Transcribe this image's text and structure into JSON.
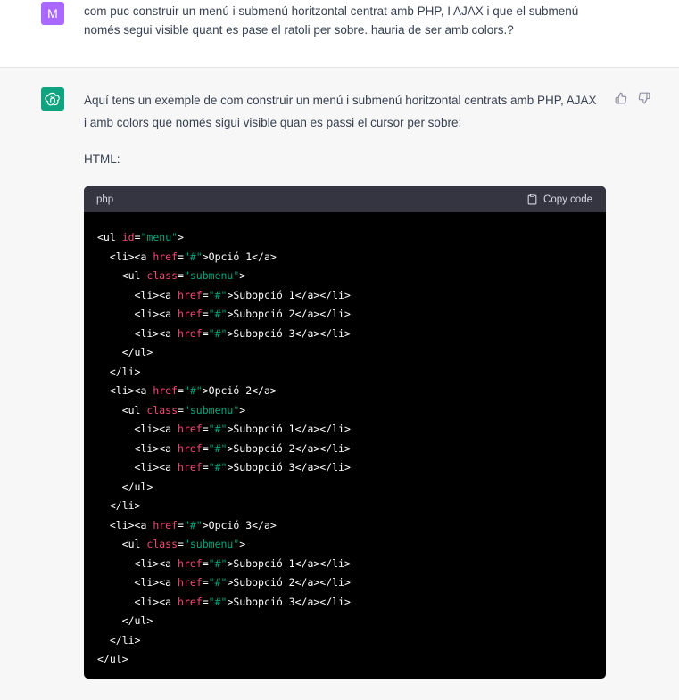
{
  "user_message": {
    "avatar_initial": "M",
    "text": "com puc construir un menú i submenú horitzontal centrat amb PHP, I AJAX i que el submenú només segui visible quant es pase el ratoli per sobre. hauria de ser amb colors.?"
  },
  "assistant_message": {
    "intro": "Aquí tens un exemple de com construir un menú i submenú horitzontal centrats amb PHP, AJAX i amb colors que només sigui visible quan es passi el cursor per sobre:",
    "html_label": "HTML:",
    "code_block": {
      "language": "php",
      "copy_label": "Copy code",
      "lines": [
        [
          {
            "t": "plain",
            "s": "<ul "
          },
          {
            "t": "attr",
            "s": "id"
          },
          {
            "t": "plain",
            "s": "="
          },
          {
            "t": "val",
            "s": "\"menu\""
          },
          {
            "t": "plain",
            "s": ">"
          }
        ],
        [
          {
            "t": "plain",
            "s": "  <li><a "
          },
          {
            "t": "attr",
            "s": "href"
          },
          {
            "t": "plain",
            "s": "="
          },
          {
            "t": "val",
            "s": "\"#\""
          },
          {
            "t": "plain",
            "s": ">Opció 1</a>"
          }
        ],
        [
          {
            "t": "plain",
            "s": "    <ul "
          },
          {
            "t": "attr",
            "s": "class"
          },
          {
            "t": "plain",
            "s": "="
          },
          {
            "t": "val",
            "s": "\"submenu\""
          },
          {
            "t": "plain",
            "s": ">"
          }
        ],
        [
          {
            "t": "plain",
            "s": "      <li><a "
          },
          {
            "t": "attr",
            "s": "href"
          },
          {
            "t": "plain",
            "s": "="
          },
          {
            "t": "val",
            "s": "\"#\""
          },
          {
            "t": "plain",
            "s": ">Subopció 1</a></li>"
          }
        ],
        [
          {
            "t": "plain",
            "s": "      <li><a "
          },
          {
            "t": "attr",
            "s": "href"
          },
          {
            "t": "plain",
            "s": "="
          },
          {
            "t": "val",
            "s": "\"#\""
          },
          {
            "t": "plain",
            "s": ">Subopció 2</a></li>"
          }
        ],
        [
          {
            "t": "plain",
            "s": "      <li><a "
          },
          {
            "t": "attr",
            "s": "href"
          },
          {
            "t": "plain",
            "s": "="
          },
          {
            "t": "val",
            "s": "\"#\""
          },
          {
            "t": "plain",
            "s": ">Subopció 3</a></li>"
          }
        ],
        [
          {
            "t": "plain",
            "s": "    </ul>"
          }
        ],
        [
          {
            "t": "plain",
            "s": "  </li>"
          }
        ],
        [
          {
            "t": "plain",
            "s": "  <li><a "
          },
          {
            "t": "attr",
            "s": "href"
          },
          {
            "t": "plain",
            "s": "="
          },
          {
            "t": "val",
            "s": "\"#\""
          },
          {
            "t": "plain",
            "s": ">Opció 2</a>"
          }
        ],
        [
          {
            "t": "plain",
            "s": "    <ul "
          },
          {
            "t": "attr",
            "s": "class"
          },
          {
            "t": "plain",
            "s": "="
          },
          {
            "t": "val",
            "s": "\"submenu\""
          },
          {
            "t": "plain",
            "s": ">"
          }
        ],
        [
          {
            "t": "plain",
            "s": "      <li><a "
          },
          {
            "t": "attr",
            "s": "href"
          },
          {
            "t": "plain",
            "s": "="
          },
          {
            "t": "val",
            "s": "\"#\""
          },
          {
            "t": "plain",
            "s": ">Subopció 1</a></li>"
          }
        ],
        [
          {
            "t": "plain",
            "s": "      <li><a "
          },
          {
            "t": "attr",
            "s": "href"
          },
          {
            "t": "plain",
            "s": "="
          },
          {
            "t": "val",
            "s": "\"#\""
          },
          {
            "t": "plain",
            "s": ">Subopció 2</a></li>"
          }
        ],
        [
          {
            "t": "plain",
            "s": "      <li><a "
          },
          {
            "t": "attr",
            "s": "href"
          },
          {
            "t": "plain",
            "s": "="
          },
          {
            "t": "val",
            "s": "\"#\""
          },
          {
            "t": "plain",
            "s": ">Subopció 3</a></li>"
          }
        ],
        [
          {
            "t": "plain",
            "s": "    </ul>"
          }
        ],
        [
          {
            "t": "plain",
            "s": "  </li>"
          }
        ],
        [
          {
            "t": "plain",
            "s": "  <li><a "
          },
          {
            "t": "attr",
            "s": "href"
          },
          {
            "t": "plain",
            "s": "="
          },
          {
            "t": "val",
            "s": "\"#\""
          },
          {
            "t": "plain",
            "s": ">Opció 3</a>"
          }
        ],
        [
          {
            "t": "plain",
            "s": "    <ul "
          },
          {
            "t": "attr",
            "s": "class"
          },
          {
            "t": "plain",
            "s": "="
          },
          {
            "t": "val",
            "s": "\"submenu\""
          },
          {
            "t": "plain",
            "s": ">"
          }
        ],
        [
          {
            "t": "plain",
            "s": "      <li><a "
          },
          {
            "t": "attr",
            "s": "href"
          },
          {
            "t": "plain",
            "s": "="
          },
          {
            "t": "val",
            "s": "\"#\""
          },
          {
            "t": "plain",
            "s": ">Subopció 1</a></li>"
          }
        ],
        [
          {
            "t": "plain",
            "s": "      <li><a "
          },
          {
            "t": "attr",
            "s": "href"
          },
          {
            "t": "plain",
            "s": "="
          },
          {
            "t": "val",
            "s": "\"#\""
          },
          {
            "t": "plain",
            "s": ">Subopció 2</a></li>"
          }
        ],
        [
          {
            "t": "plain",
            "s": "      <li><a "
          },
          {
            "t": "attr",
            "s": "href"
          },
          {
            "t": "plain",
            "s": "="
          },
          {
            "t": "val",
            "s": "\"#\""
          },
          {
            "t": "plain",
            "s": ">Subopció 3</a></li>"
          }
        ],
        [
          {
            "t": "plain",
            "s": "    </ul>"
          }
        ],
        [
          {
            "t": "plain",
            "s": "  </li>"
          }
        ],
        [
          {
            "t": "plain",
            "s": "</ul>"
          }
        ]
      ]
    }
  },
  "icons": {
    "assistant_avatar": "openai-logo-icon",
    "thumbs_up": "thumbs-up-icon",
    "thumbs_down": "thumbs-down-icon",
    "copy": "clipboard-icon"
  },
  "colors": {
    "user_avatar": "#ab68ff",
    "assistant_avatar": "#10a37f",
    "assistant_bg": "#f7f7f8",
    "code_header_bg": "#343541",
    "code_bg": "#000000",
    "code_attr": "#ef4b73",
    "code_string": "#00a67d"
  }
}
